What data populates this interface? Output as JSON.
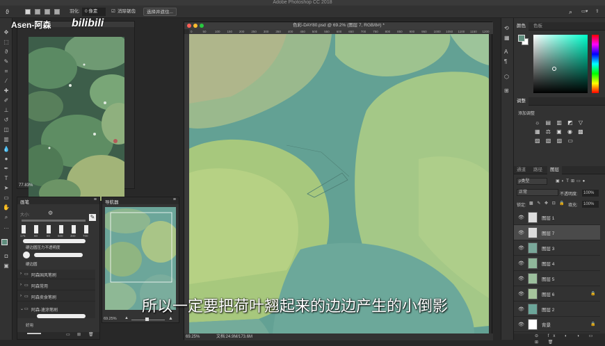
{
  "app": {
    "window_title": "Adobe Photoshop CC 2018"
  },
  "options_bar": {
    "feather_label": "羽化:",
    "feather_value": "0 像素",
    "antialias_label": "消除锯齿",
    "select_mask_label": "选择并遮住..."
  },
  "watermark": {
    "text": "Asen-阿森",
    "logo": "bilibili"
  },
  "reference_panel": {
    "zoom": "77.83%"
  },
  "brush_panel": {
    "tab": "画笔",
    "size_label": "大小:",
    "preset_sizes": [
      "175",
      "60",
      "80",
      "600",
      "300",
      "700"
    ],
    "presets": [
      "硬边圆压力不透明度",
      "硬边圆"
    ],
    "groups": [
      "阿森国风笔刷",
      "阿森常用",
      "阿森卖食笔刷",
      "阿森-速涂笔刷"
    ],
    "brush_name": "好用"
  },
  "navigator_panel": {
    "tab": "导航器",
    "zoom": "69.25%"
  },
  "document": {
    "title": "色彩-DAY80.psd @ 69.2% (图层 7, RGB/8#) *",
    "ruler_ticks": [
      "0",
      "50",
      "100",
      "150",
      "200",
      "250",
      "300",
      "350",
      "400",
      "450",
      "500",
      "550",
      "600",
      "650",
      "700",
      "750",
      "800",
      "850",
      "900",
      "950",
      "1000",
      "1050",
      "1100",
      "1150",
      "1200"
    ],
    "zoom": "69.25%",
    "doc_size": "文档:24.9M/173.6M"
  },
  "color_panel": {
    "tabs": [
      "颜色",
      "色板"
    ],
    "fg_color": "#5f8d7d",
    "bg_color": "#ffffff"
  },
  "adjustments_panel": {
    "tab": "调整",
    "add_label": "添加调整"
  },
  "layers_panel": {
    "tabs": [
      "通道",
      "路径",
      "图层"
    ],
    "filter_label": "ρ类型",
    "blend_mode": "正常",
    "opacity_label": "不透明度:",
    "opacity_value": "100%",
    "lock_label": "锁定:",
    "fill_label": "填充:",
    "fill_value": "100%",
    "layers": [
      {
        "name": "图层 1",
        "locked": false
      },
      {
        "name": "图层 7",
        "locked": false,
        "selected": true
      },
      {
        "name": "图层 3",
        "locked": false
      },
      {
        "name": "图层 4",
        "locked": false
      },
      {
        "name": "图层 5",
        "locked": false
      },
      {
        "name": "图层 6",
        "locked": true
      },
      {
        "name": "图层 2",
        "locked": false
      },
      {
        "name": "背景",
        "locked": true
      }
    ]
  },
  "subtitle": {
    "text": "所以一定要把荷叶翘起来的边边产生的小倒影"
  }
}
